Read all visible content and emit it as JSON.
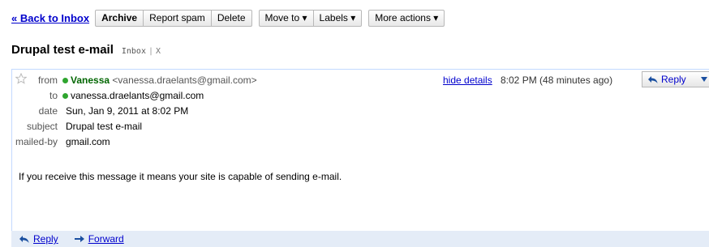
{
  "toolbar": {
    "back_label": "« Back to Inbox",
    "archive_label": "Archive",
    "report_spam_label": "Report spam",
    "delete_label": "Delete",
    "move_to_label": "Move to ▾",
    "labels_label": "Labels ▾",
    "more_actions_label": "More actions ▾"
  },
  "conversation": {
    "subject": "Drupal test e-mail",
    "label_tag": "Inbox",
    "label_remove": "X"
  },
  "message": {
    "star_icon": "star-outline-icon",
    "from_label": "from",
    "from_name": "Vanessa",
    "from_email": "<vanessa.draelants@gmail.com>",
    "to_label": "to",
    "to_email": "vanessa.draelants@gmail.com",
    "date_label": "date",
    "date_value": "Sun, Jan 9, 2011 at 8:02 PM",
    "subject_label": "subject",
    "subject_value": "Drupal test e-mail",
    "mailedby_label": "mailed-by",
    "mailedby_value": "gmail.com",
    "hide_details_label": "hide details",
    "time_text": "8:02 PM (48 minutes ago)",
    "reply_label": "Reply",
    "body": "If you receive this message it means your site is capable of sending e-mail."
  },
  "footer": {
    "reply_label": "Reply",
    "forward_label": "Forward"
  },
  "colors": {
    "link": "#0000cc",
    "presence_green": "#2fa52f",
    "message_border": "#c3d9ff",
    "footer_bg": "#e4ecf7"
  }
}
